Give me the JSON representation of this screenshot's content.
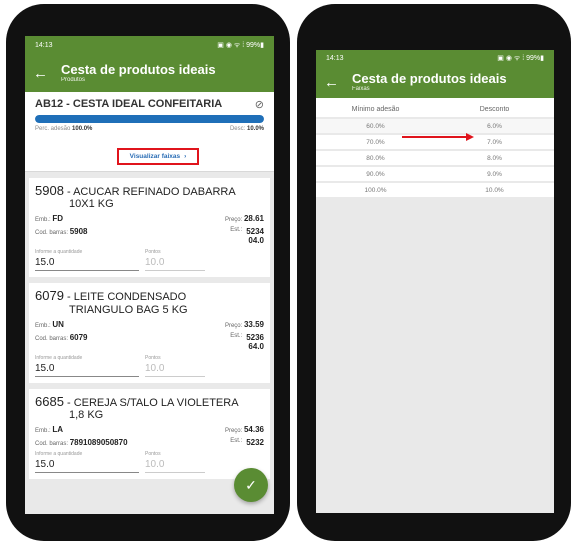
{
  "left": {
    "status": {
      "time": "14:13",
      "icons": "▣ ◉ ᯤ ⁞ 99%▮"
    },
    "appbar": {
      "title": "Cesta de produtos ideais",
      "subtitle": "Produtos"
    },
    "header": {
      "cesta_name": "AB12 - CESTA IDEAL CONFEITARIA",
      "adesao_label": "Perc. adesão",
      "adesao_value": "100.0%",
      "desc_label": "Desc:",
      "desc_value": "10.0%",
      "progress": 1.0,
      "faixas_button": "Visualizar faixas"
    },
    "products": [
      {
        "code": "5908",
        "name_line1": " - ACUCAR REFINADO DABARRA",
        "name_line2": "10X1 KG",
        "emb_label": "Emb.:",
        "emb": "FD",
        "preco_label": "Preço:",
        "preco": "28.61",
        "barras_label": "Cod. barras:",
        "barras": "5908",
        "est_label": "Est.:",
        "est1": "5234",
        "est2": "04.0",
        "qtd_label": "Informe a quantidade",
        "qtd": "15.0",
        "pontos_label": "Pontos",
        "pontos": "10.0"
      },
      {
        "code": "6079",
        "name_line1": " - LEITE CONDENSADO",
        "name_line2": "TRIANGULO BAG 5 KG",
        "emb_label": "Emb.:",
        "emb": "UN",
        "preco_label": "Preço:",
        "preco": "33.59",
        "barras_label": "Cod. barras:",
        "barras": "6079",
        "est_label": "Est.:",
        "est1": "5236",
        "est2": "64.0",
        "qtd_label": "Informe a quantidade",
        "qtd": "15.0",
        "pontos_label": "Pontos",
        "pontos": "10.0"
      },
      {
        "code": "6685",
        "name_line1": " - CEREJA S/TALO LA VIOLETERA",
        "name_line2": "1,8 KG",
        "emb_label": "Emb.:",
        "emb": "LA",
        "preco_label": "Preço:",
        "preco": "54.36",
        "barras_label": "Cod. barras:",
        "barras": "7891089050870",
        "est_label": "Est.:",
        "est1": "5232",
        "est2": "",
        "qtd_label": "Informe a quantidade",
        "qtd": "15.0",
        "pontos_label": "Pontos",
        "pontos": "10.0"
      }
    ],
    "fab_icon": "check-icon"
  },
  "right": {
    "status": {
      "time": "14:13",
      "icons": "▣ ◉ ᯤ ⁞ 99%▮"
    },
    "appbar": {
      "title": "Cesta de produtos ideais",
      "subtitle": "Faixas"
    },
    "table": {
      "col_min": "Mínimo adesão",
      "col_desc": "Desconto",
      "rows": [
        {
          "min": "60.0%",
          "desc": "6.0%"
        },
        {
          "min": "70.0%",
          "desc": "7.0%"
        },
        {
          "min": "80.0%",
          "desc": "8.0%"
        },
        {
          "min": "90.0%",
          "desc": "9.0%"
        },
        {
          "min": "100.0%",
          "desc": "10.0%"
        }
      ]
    }
  },
  "colors": {
    "primary": "#5a8c33",
    "highlight": "#e0141c",
    "progress": "#1f6fb8",
    "link": "#2a6db5"
  }
}
